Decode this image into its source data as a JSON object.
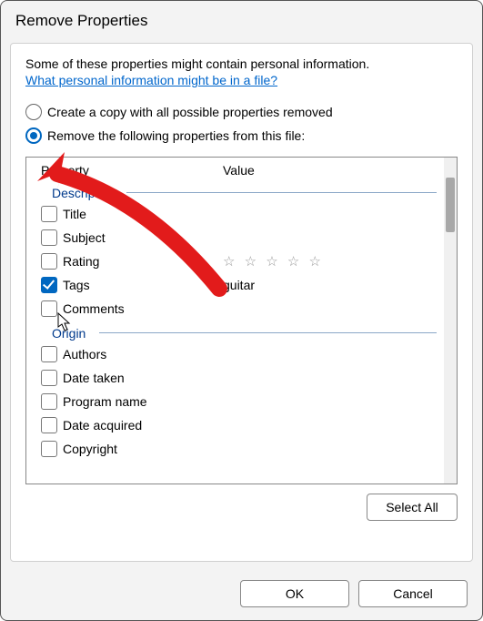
{
  "title": "Remove Properties",
  "intro": "Some of these properties might contain personal information.",
  "link": "What personal information might be in a file?",
  "radio": {
    "create_copy": "Create a copy with all possible properties removed",
    "remove_following": "Remove the following properties from this file:"
  },
  "columns": {
    "property": "Property",
    "value": "Value"
  },
  "groups": {
    "description": {
      "title": "Description",
      "items": [
        {
          "label": "Title",
          "value": "",
          "checked": false
        },
        {
          "label": "Subject",
          "value": "",
          "checked": false
        },
        {
          "label": "Rating",
          "value_stars": "☆ ☆ ☆ ☆ ☆",
          "checked": false
        },
        {
          "label": "Tags",
          "value": "guitar",
          "checked": true
        },
        {
          "label": "Comments",
          "value": "",
          "checked": false
        }
      ]
    },
    "origin": {
      "title": "Origin",
      "items": [
        {
          "label": "Authors",
          "value": "",
          "checked": false
        },
        {
          "label": "Date taken",
          "value": "",
          "checked": false
        },
        {
          "label": "Program name",
          "value": "",
          "checked": false
        },
        {
          "label": "Date acquired",
          "value": "",
          "checked": false
        },
        {
          "label": "Copyright",
          "value": "",
          "checked": false
        }
      ]
    }
  },
  "buttons": {
    "select_all": "Select All",
    "ok": "OK",
    "cancel": "Cancel"
  }
}
